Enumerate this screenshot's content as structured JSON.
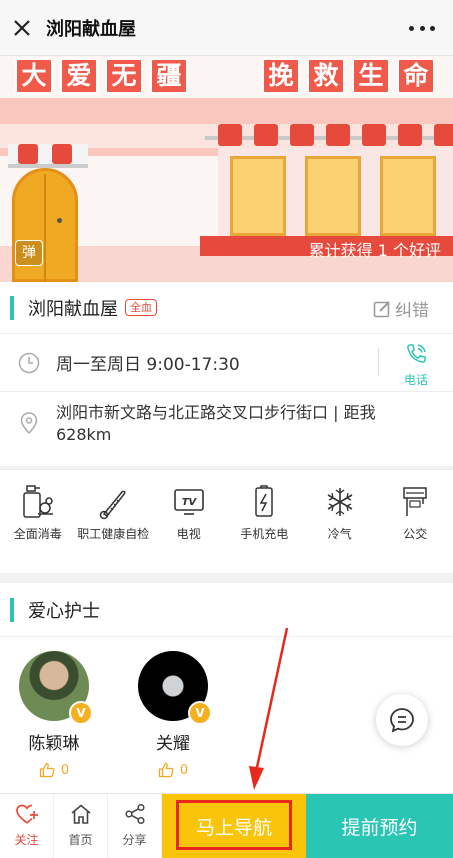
{
  "topbar": {
    "title": "浏阳献血屋"
  },
  "banner": {
    "slogan_left": [
      "大",
      "爱",
      "无",
      "疆"
    ],
    "slogan_right": [
      "挽",
      "救",
      "生",
      "命"
    ],
    "danmaku_label": "弹",
    "review_text": "累计获得 1 个好评"
  },
  "station": {
    "name": "浏阳献血屋",
    "tag": "全血",
    "correction_label": "纠错",
    "hours": "周一至周日 9:00-17:30",
    "phone_label": "电话",
    "address": "浏阳市新文路与北正路交叉口步行街口 | 距我628km"
  },
  "facilities": [
    {
      "icon": "sanitizer-icon",
      "label": "全面消毒"
    },
    {
      "icon": "thermometer-icon",
      "label": "职工健康自检"
    },
    {
      "icon": "tv-icon",
      "label": "电视"
    },
    {
      "icon": "phone-charging-icon",
      "label": "手机充电"
    },
    {
      "icon": "snowflake-icon",
      "label": "冷气"
    },
    {
      "icon": "bus-icon",
      "label": "公交"
    }
  ],
  "nurses_section": {
    "title": "爱心护士",
    "nurses": [
      {
        "name": "陈颖琳",
        "likes": "0",
        "badge": "V"
      },
      {
        "name": "关耀",
        "likes": "0",
        "badge": "V"
      }
    ]
  },
  "bottom_bar": {
    "follow": "关注",
    "home": "首页",
    "share": "分享",
    "navigate": "马上导航",
    "book": "提前预约"
  },
  "colors": {
    "accent": "#2bc5b4",
    "navigate_bg": "#f9c40a",
    "highlight": "#e8281c"
  }
}
